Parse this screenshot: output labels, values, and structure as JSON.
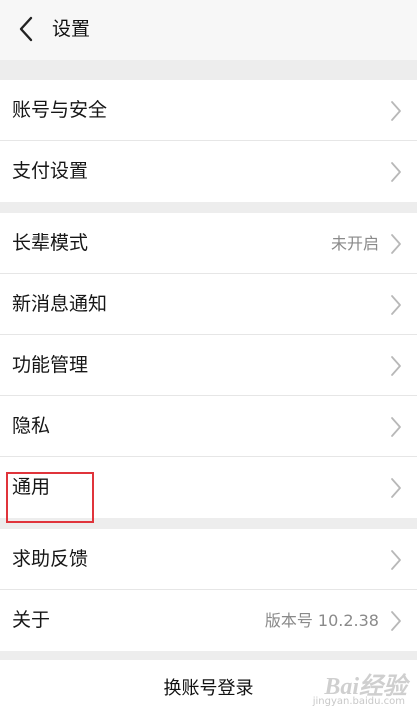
{
  "header": {
    "title": "设置",
    "back_icon": "chevron-left-icon"
  },
  "account_group": {
    "items": [
      {
        "label": "账号与安全",
        "value": ""
      },
      {
        "label": "支付设置",
        "value": ""
      }
    ]
  },
  "settings_group": {
    "items": [
      {
        "label": "长辈模式",
        "value": "未开启"
      },
      {
        "label": "新消息通知",
        "value": ""
      },
      {
        "label": "功能管理",
        "value": ""
      },
      {
        "label": "隐私",
        "value": ""
      },
      {
        "label": "通用",
        "value": ""
      }
    ]
  },
  "about_group": {
    "items": [
      {
        "label": "求助反馈",
        "value": ""
      },
      {
        "label": "关于",
        "value": "版本号 10.2.38"
      }
    ]
  },
  "footer": {
    "switch_account_label": "换账号登录"
  },
  "watermark": {
    "logo_text": "Bai经验",
    "sub_text": "jingyan.baidu.com"
  },
  "colors": {
    "highlight": "#e0343b",
    "background": "#ededed",
    "chevron": "#b8b8b8"
  }
}
